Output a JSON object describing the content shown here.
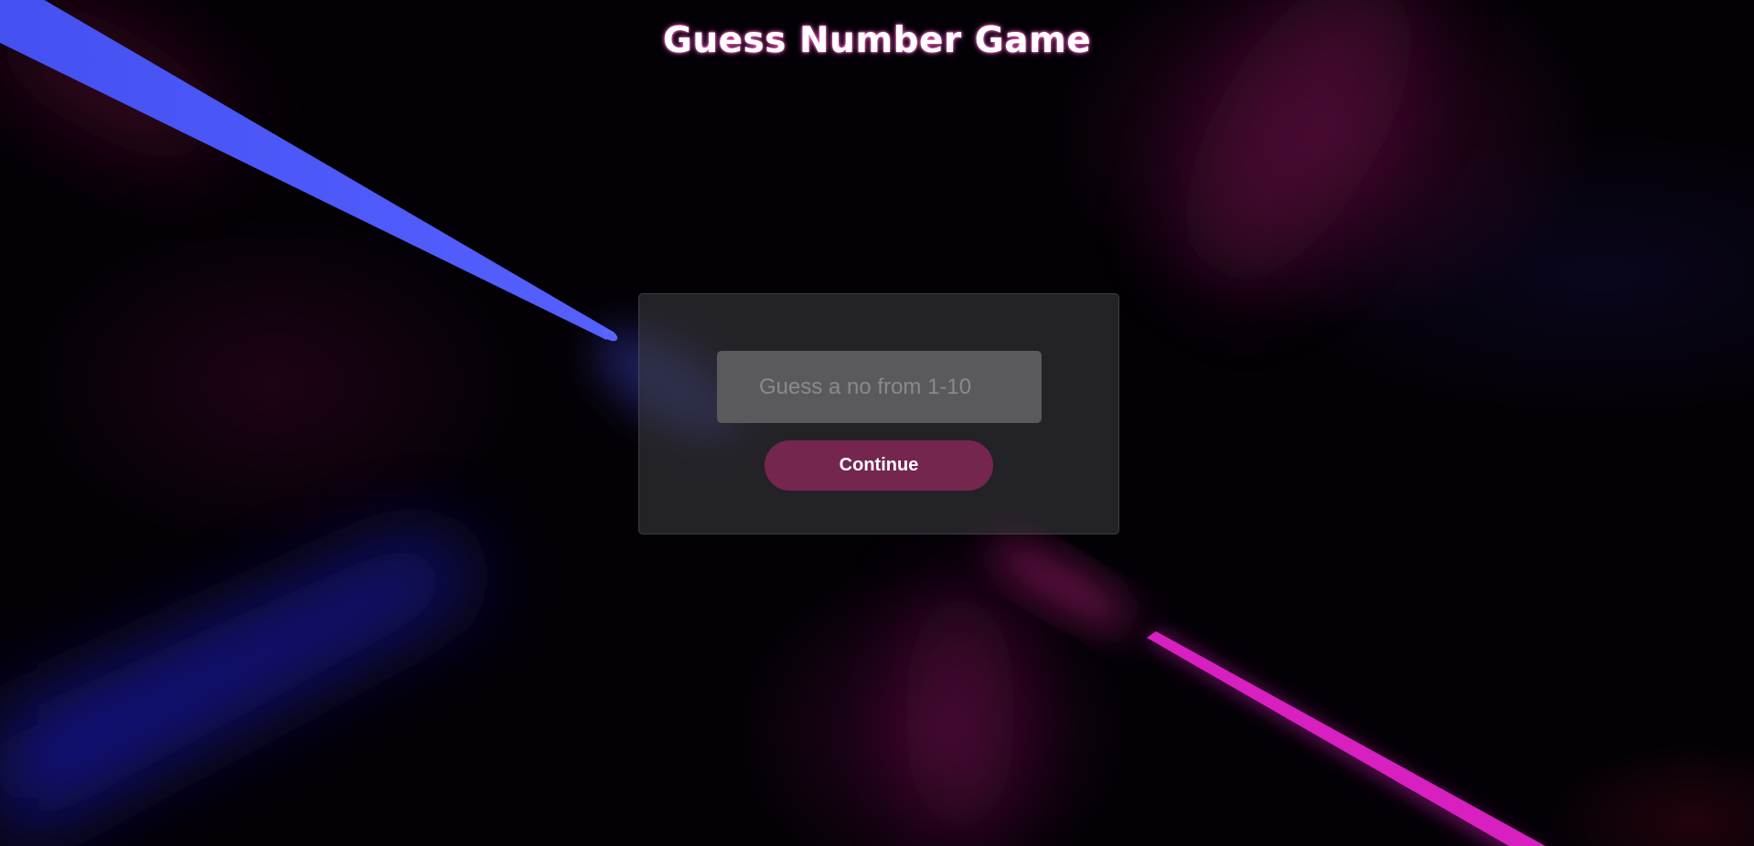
{
  "header": {
    "title": "Guess Number Game"
  },
  "form": {
    "input_value": "",
    "input_placeholder": "Guess a no from 1-10",
    "continue_label": "Continue"
  },
  "theme": {
    "title_glow": "#ff66cc",
    "button_color": "#74264f",
    "card_color": "#3e3e42",
    "input_color": "#5a5a5c",
    "beam_blue": "#4a55ff",
    "beam_magenta": "#e21fc6"
  }
}
